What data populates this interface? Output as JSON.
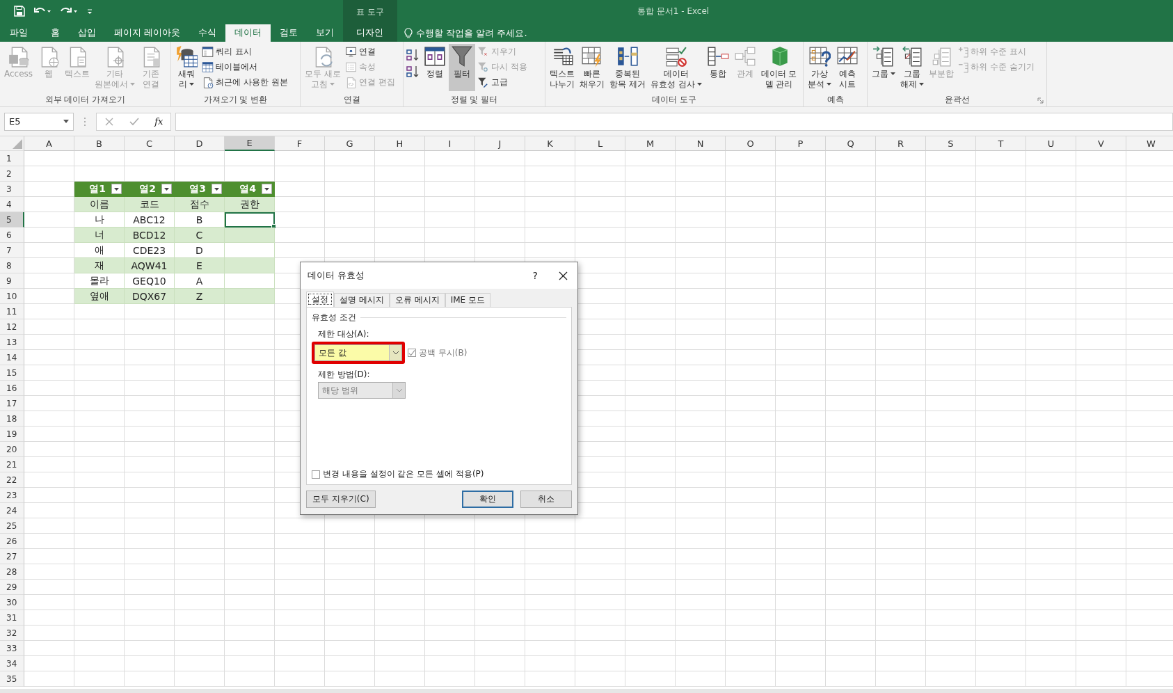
{
  "window": {
    "title": "통합 문서1 - Excel",
    "context_label": "표 도구"
  },
  "ribbon_tabs": [
    {
      "label": "파일",
      "selected": false,
      "contextual": false
    },
    {
      "label": "홈",
      "selected": false,
      "contextual": false
    },
    {
      "label": "삽입",
      "selected": false,
      "contextual": false
    },
    {
      "label": "페이지 레이아웃",
      "selected": false,
      "contextual": false
    },
    {
      "label": "수식",
      "selected": false,
      "contextual": false
    },
    {
      "label": "데이터",
      "selected": true,
      "contextual": false
    },
    {
      "label": "검토",
      "selected": false,
      "contextual": false
    },
    {
      "label": "보기",
      "selected": false,
      "contextual": false
    },
    {
      "label": "디자인",
      "selected": false,
      "contextual": true
    }
  ],
  "tell_me": "수행할 작업을 알려 주세요.",
  "ribbon_groups": [
    {
      "label": "외부 데이터 가져오기",
      "launcher": false,
      "items": [
        {
          "kind": "large",
          "label": "Access",
          "disabled": true,
          "dropdown": false,
          "pressed": false
        },
        {
          "kind": "large",
          "label": "웹",
          "disabled": true,
          "dropdown": false,
          "pressed": false
        },
        {
          "kind": "large",
          "label": "텍스트",
          "disabled": true,
          "dropdown": false,
          "pressed": false
        },
        {
          "kind": "large",
          "label": "기타\n원본에서",
          "disabled": true,
          "dropdown": true,
          "pressed": false
        },
        {
          "kind": "large",
          "label": "기존\n연결",
          "disabled": true,
          "dropdown": false,
          "pressed": false
        }
      ]
    },
    {
      "label": "가져오기 및 변환",
      "launcher": false,
      "items": [
        {
          "kind": "large",
          "label": "새쿼\n리",
          "disabled": false,
          "dropdown": true,
          "pressed": false
        },
        {
          "kind": "stack",
          "buttons": [
            {
              "label": "쿼리 표시",
              "disabled": false
            },
            {
              "label": "테이블에서",
              "disabled": false
            },
            {
              "label": "최근에 사용한 원본",
              "disabled": false
            }
          ]
        }
      ]
    },
    {
      "label": "연결",
      "launcher": false,
      "items": [
        {
          "kind": "large",
          "label": "모두 새로\n고침",
          "disabled": true,
          "dropdown": true,
          "pressed": false
        },
        {
          "kind": "stack",
          "buttons": [
            {
              "label": "연결",
              "disabled": false
            },
            {
              "label": "속성",
              "disabled": true
            },
            {
              "label": "연결 편집",
              "disabled": true
            }
          ]
        }
      ]
    },
    {
      "label": "정렬 및 필터",
      "launcher": false,
      "items": [
        {
          "kind": "sort_icons"
        },
        {
          "kind": "large",
          "label": "정렬",
          "disabled": false,
          "dropdown": false,
          "pressed": false
        },
        {
          "kind": "large",
          "label": "필터",
          "disabled": false,
          "dropdown": false,
          "pressed": true
        },
        {
          "kind": "stack",
          "buttons": [
            {
              "label": "지우기",
              "disabled": true
            },
            {
              "label": "다시 적용",
              "disabled": true
            },
            {
              "label": "고급",
              "disabled": false
            }
          ]
        }
      ]
    },
    {
      "label": "데이터 도구",
      "launcher": false,
      "items": [
        {
          "kind": "large",
          "label": "텍스트\n나누기",
          "disabled": false,
          "dropdown": false,
          "pressed": false
        },
        {
          "kind": "large",
          "label": "빠른\n채우기",
          "disabled": false,
          "dropdown": false,
          "pressed": false
        },
        {
          "kind": "large",
          "label": "중복된\n항목 제거",
          "disabled": false,
          "dropdown": false,
          "pressed": false
        },
        {
          "kind": "large",
          "label": "데이터\n유효성 검사",
          "disabled": false,
          "dropdown": true,
          "pressed": false
        },
        {
          "kind": "large",
          "label": "통합",
          "disabled": false,
          "dropdown": false,
          "pressed": false
        },
        {
          "kind": "large",
          "label": "관계",
          "disabled": true,
          "dropdown": false,
          "pressed": false
        },
        {
          "kind": "large",
          "label": "데이터 모\n델 관리",
          "disabled": false,
          "dropdown": false,
          "pressed": false
        }
      ]
    },
    {
      "label": "예측",
      "launcher": false,
      "items": [
        {
          "kind": "large",
          "label": "가상\n분석",
          "disabled": false,
          "dropdown": true,
          "pressed": false
        },
        {
          "kind": "large",
          "label": "예측\n시트",
          "disabled": false,
          "dropdown": false,
          "pressed": false
        }
      ]
    },
    {
      "label": "윤곽선",
      "launcher": true,
      "items": [
        {
          "kind": "large",
          "label": "그룹",
          "disabled": false,
          "dropdown": true,
          "pressed": false
        },
        {
          "kind": "large",
          "label": "그룹\n해제",
          "disabled": false,
          "dropdown": true,
          "pressed": false
        },
        {
          "kind": "large",
          "label": "부분합",
          "disabled": true,
          "dropdown": false,
          "pressed": false
        },
        {
          "kind": "stack",
          "buttons": [
            {
              "label": "하위 수준 표시",
              "disabled": true
            },
            {
              "label": "하위 수준 숨기기",
              "disabled": true
            }
          ]
        }
      ]
    }
  ],
  "formula_bar": {
    "name_box": "E5",
    "function_label": "fx"
  },
  "columns": [
    {
      "label": "A",
      "selected": false
    },
    {
      "label": "B",
      "selected": false
    },
    {
      "label": "C",
      "selected": false
    },
    {
      "label": "D",
      "selected": false
    },
    {
      "label": "E",
      "selected": true
    },
    {
      "label": "F",
      "selected": false
    },
    {
      "label": "G",
      "selected": false
    },
    {
      "label": "H",
      "selected": false
    },
    {
      "label": "I",
      "selected": false
    },
    {
      "label": "J",
      "selected": false
    },
    {
      "label": "K",
      "selected": false
    },
    {
      "label": "L",
      "selected": false
    },
    {
      "label": "M",
      "selected": false
    },
    {
      "label": "N",
      "selected": false
    },
    {
      "label": "O",
      "selected": false
    },
    {
      "label": "P",
      "selected": false
    },
    {
      "label": "Q",
      "selected": false
    },
    {
      "label": "R",
      "selected": false
    },
    {
      "label": "S",
      "selected": false
    },
    {
      "label": "T",
      "selected": false
    },
    {
      "label": "U",
      "selected": false
    },
    {
      "label": "V",
      "selected": false
    },
    {
      "label": "W",
      "selected": false
    }
  ],
  "row_numbers": [
    {
      "label": "1",
      "selected": false
    },
    {
      "label": "2",
      "selected": false
    },
    {
      "label": "3",
      "selected": false
    },
    {
      "label": "4",
      "selected": false
    },
    {
      "label": "5",
      "selected": true
    },
    {
      "label": "6",
      "selected": false
    },
    {
      "label": "7",
      "selected": false
    },
    {
      "label": "8",
      "selected": false
    },
    {
      "label": "9",
      "selected": false
    },
    {
      "label": "10",
      "selected": false
    },
    {
      "label": "11",
      "selected": false
    },
    {
      "label": "12",
      "selected": false
    },
    {
      "label": "13",
      "selected": false
    },
    {
      "label": "14",
      "selected": false
    },
    {
      "label": "15",
      "selected": false
    },
    {
      "label": "16",
      "selected": false
    },
    {
      "label": "17",
      "selected": false
    },
    {
      "label": "18",
      "selected": false
    },
    {
      "label": "19",
      "selected": false
    },
    {
      "label": "20",
      "selected": false
    },
    {
      "label": "21",
      "selected": false
    },
    {
      "label": "22",
      "selected": false
    },
    {
      "label": "23",
      "selected": false
    },
    {
      "label": "24",
      "selected": false
    },
    {
      "label": "25",
      "selected": false
    },
    {
      "label": "26",
      "selected": false
    },
    {
      "label": "27",
      "selected": false
    },
    {
      "label": "28",
      "selected": false
    },
    {
      "label": "29",
      "selected": false
    },
    {
      "label": "30",
      "selected": false
    },
    {
      "label": "31",
      "selected": false
    },
    {
      "label": "32",
      "selected": false
    },
    {
      "label": "33",
      "selected": false
    },
    {
      "label": "34",
      "selected": false
    },
    {
      "label": "35",
      "selected": false
    }
  ],
  "table": {
    "headers": [
      "열1",
      "열2",
      "열3",
      "열4"
    ],
    "rows": [
      [
        "이름",
        "코드",
        "점수",
        "권한"
      ],
      [
        "나",
        "ABC12",
        "B"
      ],
      [
        "너",
        "BCD12",
        "C"
      ],
      [
        "애",
        "CDE23",
        "D"
      ],
      [
        "재",
        "AQW41",
        "E"
      ],
      [
        "몰라",
        "GEQ10",
        "A"
      ],
      [
        "옆애",
        "DQX67",
        "Z"
      ]
    ]
  },
  "dialog": {
    "title": "데이터 유효성",
    "help": "?",
    "tabs": [
      {
        "label": "설정",
        "selected": true
      },
      {
        "label": "설명 메시지",
        "selected": false
      },
      {
        "label": "오류 메시지",
        "selected": false
      },
      {
        "label": "IME 모드",
        "selected": false
      }
    ],
    "section": "유효성 조건",
    "allow_label": "제한 대상(A):",
    "allow_value": "모든 값",
    "allow_highlighted": true,
    "ignore_blank": {
      "label": "공백 무시(B)",
      "checked": true,
      "disabled": true
    },
    "data_label": "제한 방법(D):",
    "data_value": "해당 범위",
    "data_disabled": true,
    "apply_all": {
      "label": "변경 내용을 설정이 같은 모든 셀에 적용(P)",
      "checked": false
    },
    "buttons": [
      {
        "label": "모두 지우기(C)",
        "default": false
      },
      {
        "label": "확인",
        "default": true
      },
      {
        "label": "취소",
        "default": false
      }
    ]
  }
}
